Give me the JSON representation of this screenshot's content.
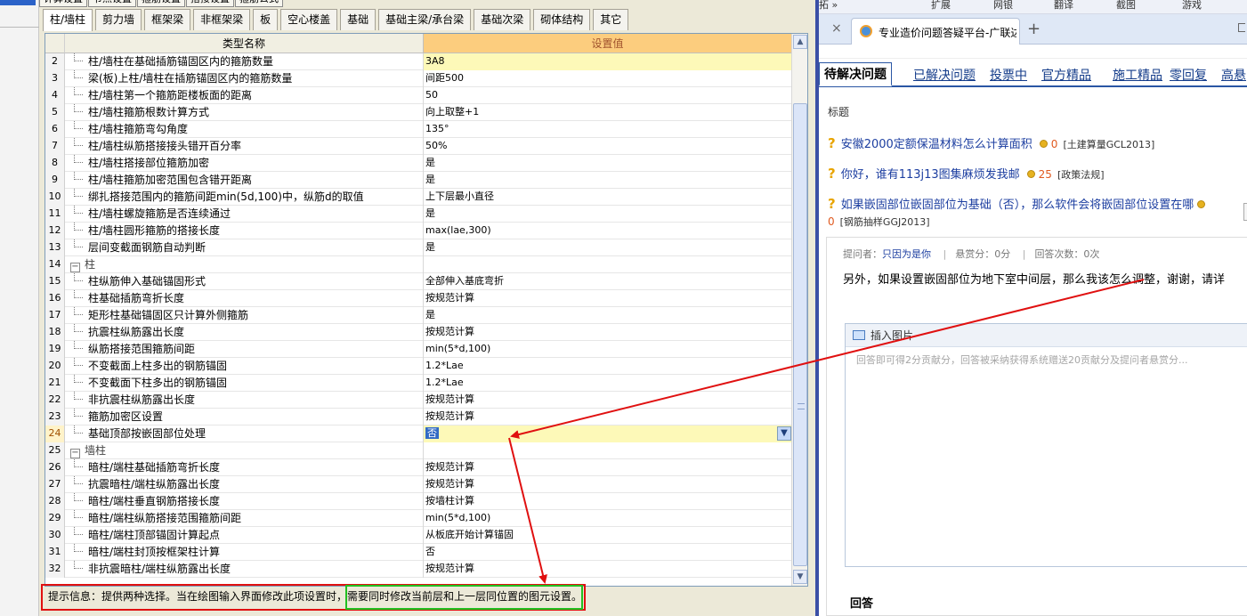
{
  "dialog": {
    "top_tabs": [
      "计算设置",
      "节点设置",
      "箍筋设置",
      "搭接设置",
      "箍筋公式"
    ],
    "category_tabs": [
      "柱/墙柱",
      "剪力墙",
      "框架梁",
      "非框架梁",
      "板",
      "空心楼盖",
      "基础",
      "基础主梁/承台梁",
      "基础次梁",
      "砌体结构",
      "其它"
    ],
    "header": {
      "name": "类型名称",
      "value": "设置值"
    },
    "rows": [
      {
        "n": "2",
        "name": "柱/墙柱在基础插筋锚固区内的箍筋数量",
        "value": "3A8"
      },
      {
        "n": "3",
        "name": "梁(板)上柱/墙柱在插筋锚固区内的箍筋数量",
        "value": "间距500"
      },
      {
        "n": "4",
        "name": "柱/墙柱第一个箍筋距楼板面的距离",
        "value": "50"
      },
      {
        "n": "5",
        "name": "柱/墙柱箍筋根数计算方式",
        "value": "向上取整+1"
      },
      {
        "n": "6",
        "name": "柱/墙柱箍筋弯勾角度",
        "value": "135°"
      },
      {
        "n": "7",
        "name": "柱/墙柱纵筋搭接接头错开百分率",
        "value": "50%"
      },
      {
        "n": "8",
        "name": "柱/墙柱搭接部位箍筋加密",
        "value": "是"
      },
      {
        "n": "9",
        "name": "柱/墙柱箍筋加密范围包含错开距离",
        "value": "是"
      },
      {
        "n": "10",
        "name": "绑扎搭接范围内的箍筋间距min(5d,100)中，纵筋d的取值",
        "value": "上下层最小直径"
      },
      {
        "n": "11",
        "name": "柱/墙柱螺旋箍筋是否连续通过",
        "value": "是"
      },
      {
        "n": "12",
        "name": "柱/墙柱圆形箍筋的搭接长度",
        "value": "max(lae,300)"
      },
      {
        "n": "13",
        "name": "层间变截面钢筋自动判断",
        "value": "是"
      },
      {
        "n": "14",
        "name": "柱",
        "value": "",
        "group": true
      },
      {
        "n": "15",
        "name": "柱纵筋伸入基础锚固形式",
        "value": "全部伸入基底弯折"
      },
      {
        "n": "16",
        "name": "柱基础插筋弯折长度",
        "value": "按规范计算"
      },
      {
        "n": "17",
        "name": "矩形柱基础锚固区只计算外侧箍筋",
        "value": "是"
      },
      {
        "n": "18",
        "name": "抗震柱纵筋露出长度",
        "value": "按规范计算"
      },
      {
        "n": "19",
        "name": "纵筋搭接范围箍筋间距",
        "value": "min(5*d,100)"
      },
      {
        "n": "20",
        "name": "不变截面上柱多出的钢筋锚固",
        "value": "1.2*Lae"
      },
      {
        "n": "21",
        "name": "不变截面下柱多出的钢筋锚固",
        "value": "1.2*Lae"
      },
      {
        "n": "22",
        "name": "非抗震柱纵筋露出长度",
        "value": "按规范计算"
      },
      {
        "n": "23",
        "name": "箍筋加密区设置",
        "value": "按规范计算"
      },
      {
        "n": "24",
        "name": "基础顶部按嵌固部位处理",
        "value": "否",
        "selected": true
      },
      {
        "n": "25",
        "name": "墙柱",
        "value": "",
        "group": true
      },
      {
        "n": "26",
        "name": "暗柱/端柱基础插筋弯折长度",
        "value": "按规范计算"
      },
      {
        "n": "27",
        "name": "抗震暗柱/端柱纵筋露出长度",
        "value": "按规范计算"
      },
      {
        "n": "28",
        "name": "暗柱/端柱垂直钢筋搭接长度",
        "value": "按墙柱计算"
      },
      {
        "n": "29",
        "name": "暗柱/端柱纵筋搭接范围箍筋间距",
        "value": "min(5*d,100)"
      },
      {
        "n": "30",
        "name": "暗柱/端柱顶部锚固计算起点",
        "value": "从板底开始计算锚固"
      },
      {
        "n": "31",
        "name": "暗柱/端柱封顶按框架柱计算",
        "value": "否"
      },
      {
        "n": "32",
        "name": "非抗震暗柱/端柱纵筋露出长度",
        "value": "按规范计算"
      }
    ],
    "hint_prefix": "提示信息：提供两种选择。当在绘图输入界面修改此项设置时，",
    "hint_highlight": "需要同时修改当前层和上一层同位置的图元设置。"
  },
  "browser": {
    "toolbar": {
      "a": "拓 »",
      "b": "扩展",
      "c": "网银",
      "d": "翻译",
      "e": "截图",
      "f": "游戏"
    },
    "tab_title": "专业造价问题答疑平台-广联达!",
    "tab_close": "×",
    "tab_add": "+",
    "q_tabs": [
      "待解决问题",
      "已解决问题",
      "投票中",
      "官方精品",
      "施工精品",
      "零回复",
      "高悬"
    ],
    "list_header": "标题",
    "questions": [
      {
        "title": "安徽2000定额保温材料怎么计算面积",
        "count": "0",
        "category": "[土建算量GCL2013]"
      },
      {
        "title": "你好，谁有113j13图集麻烦发我邮",
        "count": "25",
        "category": "[政策法规]"
      },
      {
        "title": "如果嵌固部位嵌固部位为基础（否），那么软件会将嵌固部位设置在哪",
        "count": "0",
        "category": "[钢筋抽样GGJ2013]"
      }
    ],
    "meta": {
      "asker_label": "提问者：",
      "asker": "只因为是你",
      "reward": "悬赏分：0分",
      "answers": "回答次数：0次"
    },
    "question_body": "另外，如果设置嵌固部位为地下室中间层，那么我该怎么调整，谢谢，请详",
    "editor_toolbar": "插入图片",
    "editor_placeholder": "回答即可得2分贡献分，回答被采纳获得系统赠送20贡献分及提问者悬赏分...",
    "answer_heading": "回答"
  },
  "colors": {
    "annotation_red": "#e01010",
    "annotation_green": "#22c022",
    "value_header": "#fccd7e"
  }
}
